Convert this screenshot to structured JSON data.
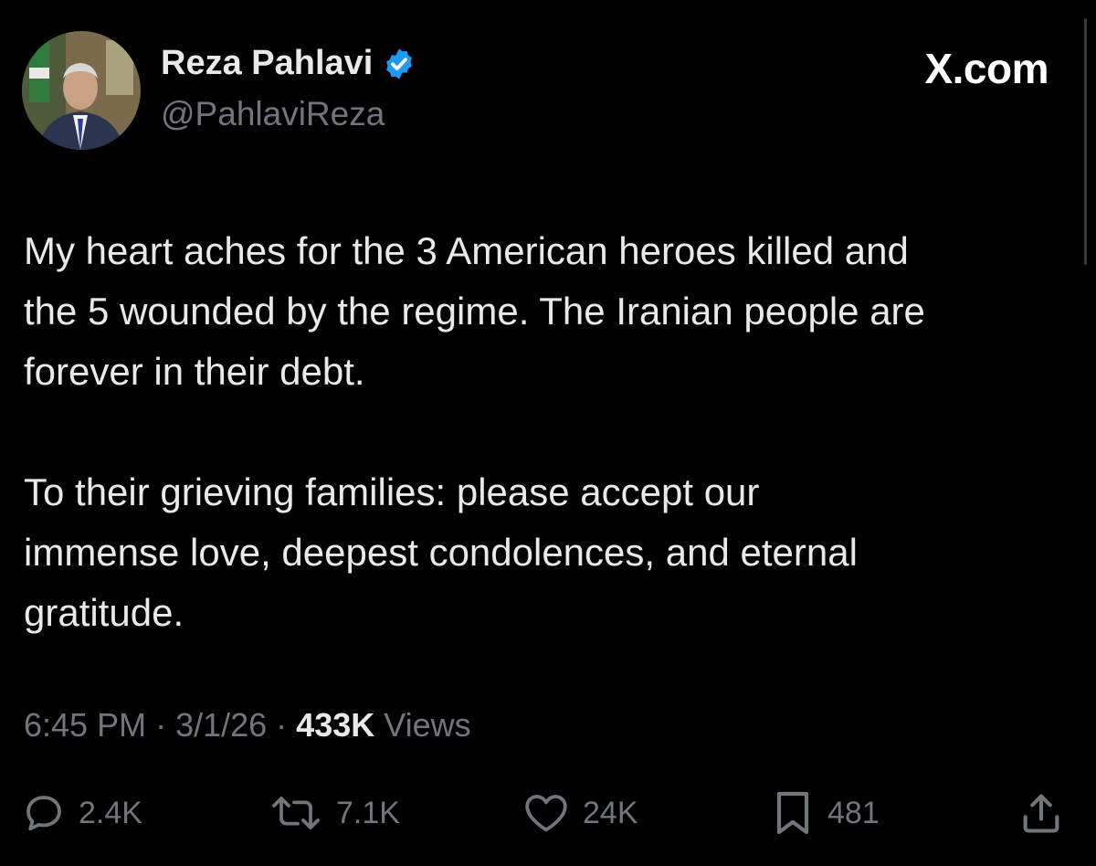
{
  "author": {
    "display_name": "Reza Pahlavi",
    "handle": "@PahlaviReza",
    "verified": true,
    "avatar_icon": "profile-photo"
  },
  "watermark": "X.com",
  "tweet": {
    "paragraphs": [
      "My heart aches for the 3 American heroes killed and\nthe 5 wounded by the regime. The Iranian people are\nforever in their debt.",
      "To their grieving families: please accept our\nimmense love, deepest condolences, and eternal\ngratitude."
    ]
  },
  "meta": {
    "time": "6:45 PM",
    "separator": " · ",
    "date": "3/1/26",
    "views_count": "433K",
    "views_label": " Views"
  },
  "actions": {
    "reply": {
      "icon": "reply-icon",
      "count": "2.4K"
    },
    "repost": {
      "icon": "repost-icon",
      "count": "7.1K"
    },
    "like": {
      "icon": "heart-icon",
      "count": "24K"
    },
    "bookmark": {
      "icon": "bookmark-icon",
      "count": "481"
    },
    "share": {
      "icon": "share-icon"
    }
  },
  "colors": {
    "background": "#000000",
    "primary_text": "#e7e9ea",
    "secondary_text": "#71767b",
    "verified_badge": "#1d9bf0"
  }
}
